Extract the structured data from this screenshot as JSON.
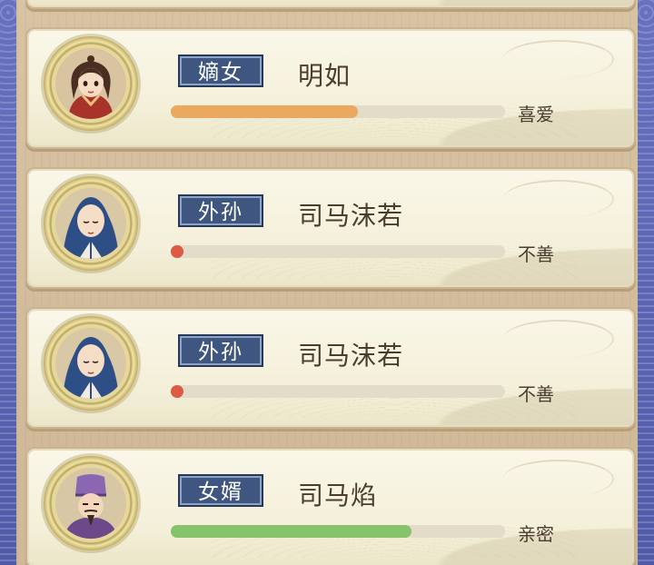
{
  "relatives": [
    {
      "relation": "嫡女",
      "name": "明如",
      "favor": 0.56,
      "favor_color": "#eba861",
      "attitude": "喜爱",
      "portrait": "woman-portrait"
    },
    {
      "relation": "外孙",
      "name": "司马沫若",
      "favor": 0.0,
      "favor_color": "#dd5a45",
      "attitude": "不善",
      "portrait": "monk-portrait"
    },
    {
      "relation": "外孙",
      "name": "司马沫若",
      "favor": 0.0,
      "favor_color": "#dd5a45",
      "attitude": "不善",
      "portrait": "monk-portrait"
    },
    {
      "relation": "女婿",
      "name": "司马焰",
      "favor": 0.72,
      "favor_color": "#86c36a",
      "attitude": "亲密",
      "portrait": "official-portrait"
    }
  ]
}
